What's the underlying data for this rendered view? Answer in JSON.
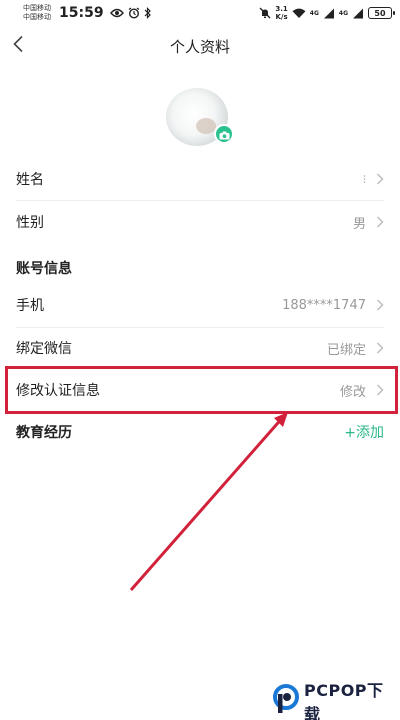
{
  "status_bar": {
    "carrier_1": "中国移动",
    "carrier_2": "中国移动",
    "time": "15:59",
    "net_speed_value": "3.1",
    "net_speed_unit": "K/s",
    "signal_tag_1": "4G",
    "signal_tag_2": "4G",
    "battery": "50"
  },
  "header": {
    "title": "个人资料"
  },
  "profile": {
    "rows": [
      {
        "label": "姓名",
        "value": ""
      },
      {
        "label": "性别",
        "value": "男"
      }
    ]
  },
  "account": {
    "section_title": "账号信息",
    "rows": [
      {
        "label": "手机",
        "value": "188****1747"
      },
      {
        "label": "绑定微信",
        "value": "已绑定"
      },
      {
        "label": "修改认证信息",
        "value": "修改"
      }
    ]
  },
  "education": {
    "section_title": "教育经历",
    "add_label": "+添加"
  },
  "colors": {
    "accent": "#2bb98a",
    "annotation": "#d2213a"
  }
}
